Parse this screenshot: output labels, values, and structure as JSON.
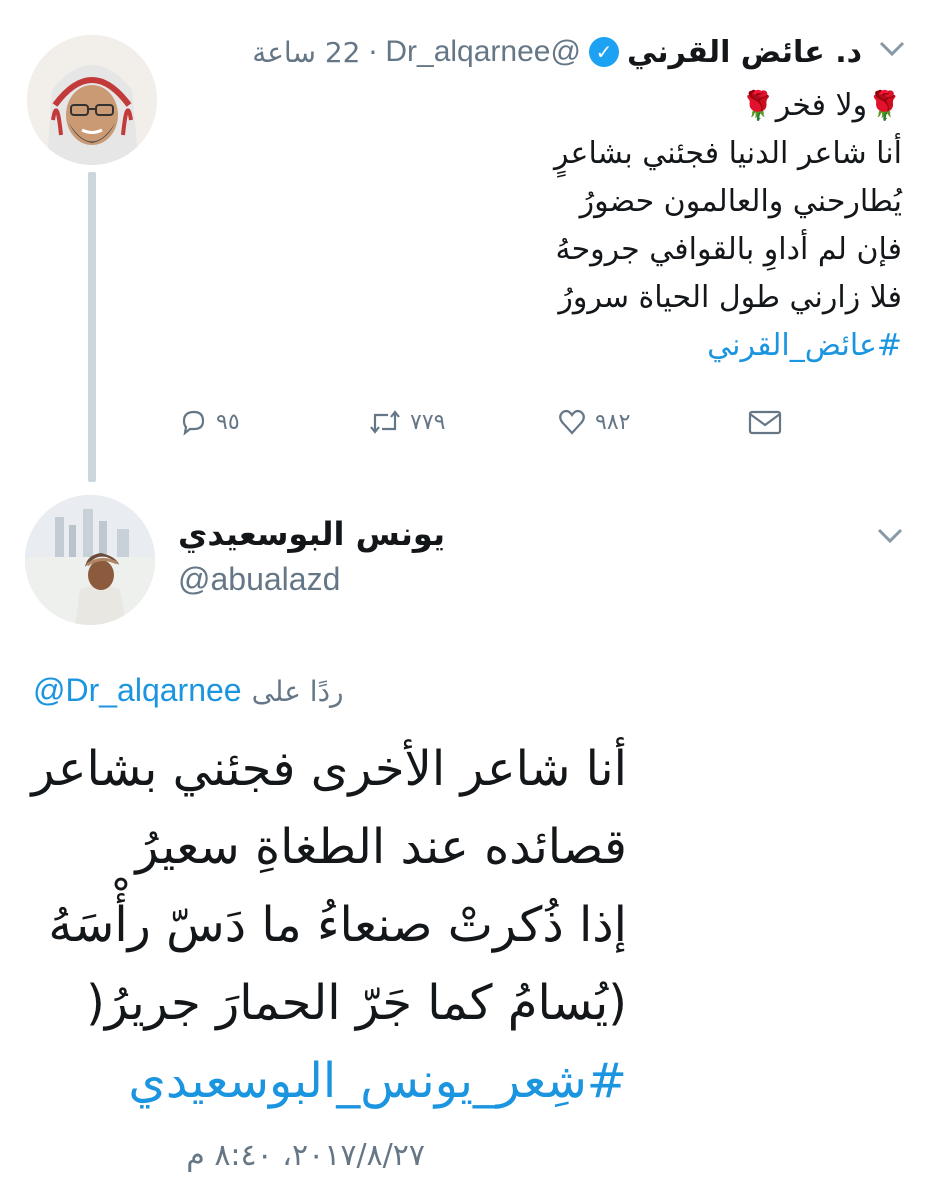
{
  "tweet1": {
    "author_name": "د. عائض القرني",
    "verified_icon": "verified-badge-icon",
    "handle": "@Dr_alqarnee",
    "time": "22 ساعة",
    "separator": "·",
    "text_lines": [
      "ولا فخر",
      "أنا شاعر الدنيا فجئني بشاعرٍ",
      "يُطارحني والعالمون حضورُ",
      "فإن لم أداوِ بالقوافي جروحهُ",
      "فلا زارني طول الحياة سرورُ"
    ],
    "emoji_icon": "rose-icon",
    "hashtag": "#عائض_القرني",
    "actions": {
      "reply_count": "٩٥",
      "retweet_count": "٧٧٩",
      "like_count": "٩٨٢"
    }
  },
  "tweet2": {
    "author_name": "يونس البوسعيدي",
    "handle": "@abualazd",
    "reply_prefix": "ردًا على",
    "reply_mention": "@Dr_alqarnee",
    "poem_lines": [
      "أنا شاعر الأخرى فجئني بشاعر",
      "قصائده عند الطغاةِ سعيرُ",
      "إذا ذُكرتْ صنعاءُ ما دَسّ رأْسَهُ",
      "(يُسامُ كما جَرّ الحمارَ جريرُ("
    ],
    "hashtag": "#شِعر_يونس_البوسعيدي",
    "timestamp": "٢٠١٧/٨/٢٧، ٨:٤٠ م"
  },
  "colors": {
    "link": "#1b95e0",
    "secondary": "#657786",
    "thread_line": "#ccd6dd",
    "verified": "#1da1f2"
  }
}
